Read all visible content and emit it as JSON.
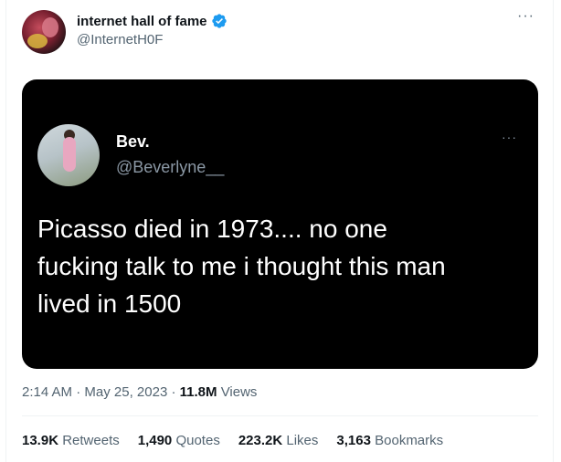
{
  "author": {
    "display_name": "internet hall of fame",
    "handle": "@InternetH0F",
    "verified_icon": "verified-badge-icon"
  },
  "tweet_menu_icon": "more-options-icon",
  "embedded": {
    "name": "Bev.",
    "handle": "@Beverlyne__",
    "text": "Picasso died in 1973.... no one\nfucking talk to me i thought this man\nlived in 1500",
    "menu_icon": "more-options-icon"
  },
  "meta": {
    "time": "2:14 AM",
    "sep1": "·",
    "date": "May 25, 2023",
    "sep2": "·",
    "views_count": "11.8M",
    "views_label": "Views"
  },
  "stats": {
    "retweets_count": "13.9K",
    "retweets_label": "Retweets",
    "quotes_count": "1,490",
    "quotes_label": "Quotes",
    "likes_count": "223.2K",
    "likes_label": "Likes",
    "bookmarks_count": "3,163",
    "bookmarks_label": "Bookmarks"
  },
  "colors": {
    "verified": "#1d9bf0",
    "card_bg": "#000000",
    "secondary_text": "#536471"
  }
}
